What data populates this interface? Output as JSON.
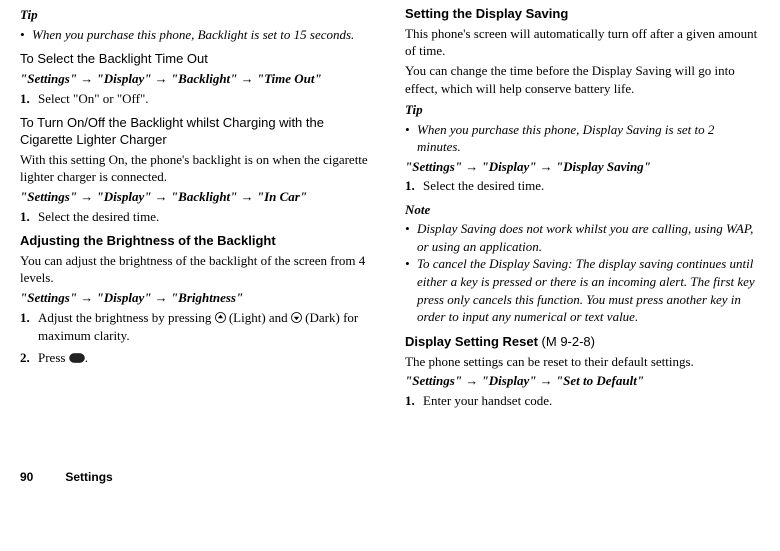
{
  "left": {
    "tip_label": "Tip",
    "tip_bullet": "•",
    "tip_text": "When you purchase this phone, Backlight is set to 15 seconds.",
    "sect1_heading": "To Select the Backlight Time Out",
    "sect1_path": "\"Settings\" → \"Display\" → \"Backlight\" → \"Time Out\"",
    "sect1_step_num": "1.",
    "sect1_step_text": "Select \"On\" or \"Off\".",
    "sect2_heading": "To Turn On/Off the Backlight whilst Charging with the Cigarette Lighter Charger",
    "sect2_body": "With this setting On, the phone's backlight is on when the cigarette lighter charger is connected.",
    "sect2_path": "\"Settings\" → \"Display\" → \"Backlight\" → \"In Car\"",
    "sect2_step_num": "1.",
    "sect2_step_text": "Select the desired time.",
    "sect3_heading": "Adjusting the Brightness of the Backlight",
    "sect3_body": "You can adjust the brightness of the backlight of the screen from 4 levels.",
    "sect3_path": "\"Settings\" → \"Display\" → \"Brightness\"",
    "sect3_step1_num": "1.",
    "sect3_step1_text_a": "Adjust the brightness by pressing ",
    "sect3_step1_text_b": " (Light) and ",
    "sect3_step1_text_c": " (Dark) for maximum clarity.",
    "sect3_step2_num": "2.",
    "sect3_step2_text_a": "Press ",
    "sect3_step2_text_b": "."
  },
  "right": {
    "sect1_heading": "Setting the Display Saving",
    "sect1_body1": "This phone's screen will automatically turn off after a given amount of time.",
    "sect1_body2": "You can change the time before the Display Saving will go into effect, which will help conserve battery life.",
    "tip_label": "Tip",
    "tip_bullet": "•",
    "tip_text": "When you purchase this phone, Display Saving is set to 2 minutes.",
    "sect1_path": "\"Settings\" → \"Display\" → \"Display Saving\"",
    "sect1_step_num": "1.",
    "sect1_step_text": "Select the desired time.",
    "note_label": "Note",
    "note1_bullet": "•",
    "note1_text": "Display Saving does not work whilst you are calling, using WAP, or using an application.",
    "note2_bullet": "•",
    "note2_text": "To cancel the Display Saving: The display saving continues until either a key is pressed or there is an incoming alert. The first key press only cancels this function. You must press another key in order to input any numerical or text value.",
    "sect2_heading_a": "Display Setting Reset ",
    "sect2_heading_b": "(M 9-2-8)",
    "sect2_body": "The phone settings can be reset to their default settings.",
    "sect2_path": "\"Settings\" → \"Display\" → \"Set to Default\"",
    "sect2_step_num": "1.",
    "sect2_step_text": "Enter your handset code."
  },
  "footer": {
    "page": "90",
    "title": "Settings"
  }
}
